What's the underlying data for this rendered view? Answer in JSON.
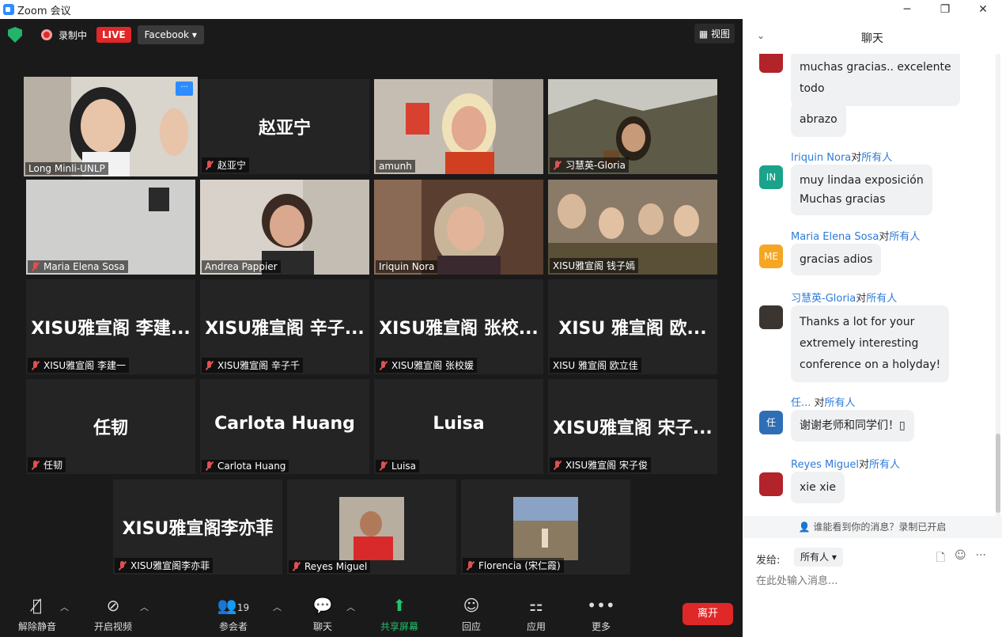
{
  "window": {
    "title": "Zoom 会议",
    "minimize": "─",
    "maximize": "❐",
    "close": "✕"
  },
  "topbar": {
    "recording": "录制中",
    "live": "LIVE",
    "stream_target": "Facebook ▾",
    "view": "▦ 视图"
  },
  "tiles": [
    {
      "label": "Long Minli-UNLP",
      "muted": false,
      "more": "···"
    },
    {
      "bigname": "赵亚宁",
      "label": "赵亚宁",
      "muted": true
    },
    {
      "label": "amunh",
      "muted": false
    },
    {
      "label": "习慧英-Gloria",
      "muted": true
    },
    {
      "label": "Maria Elena Sosa",
      "muted": true
    },
    {
      "label": "Andrea Pappier",
      "muted": false
    },
    {
      "label": "Iriquin Nora",
      "muted": false
    },
    {
      "label": "XISU雅宣阁 钱子嫣",
      "muted": false
    },
    {
      "bigname": "XISU雅宣阁 李建...",
      "label": "XISU雅宣阁 李建一",
      "muted": true
    },
    {
      "bigname": "XISU雅宣阁 辛子...",
      "label": "XISU雅宣阁 辛子千",
      "muted": true
    },
    {
      "bigname": "XISU雅宣阁 张校...",
      "label": "XISU雅宣阁 张校媛",
      "muted": true
    },
    {
      "bigname": "XISU 雅宣阁 欧...",
      "label": "XISU 雅宣阁 欧立佳",
      "muted": false
    },
    {
      "bigname": "任韧",
      "label": "任韧",
      "muted": true
    },
    {
      "bigname": "Carlota Huang",
      "label": "Carlota Huang",
      "muted": true
    },
    {
      "bigname": "Luisa",
      "label": "Luisa",
      "muted": true
    },
    {
      "bigname": "XISU雅宣阁 宋子...",
      "label": "XISU雅宣阁 宋子俊",
      "muted": true
    },
    {
      "bigname": "XISU雅宣阁李亦菲",
      "label": "XISU雅宣阁李亦菲",
      "muted": true
    },
    {
      "label": "Reyes Miguel",
      "muted": true
    },
    {
      "label": "Florencia (宋仁霞)",
      "muted": true
    }
  ],
  "toolbar": {
    "unmute": "解除静音",
    "start_video": "开启视频",
    "participants": "参会者",
    "participants_count": "19",
    "chat": "聊天",
    "share_screen": "共享屏幕",
    "reactions": "回应",
    "apps": "应用",
    "more": "更多",
    "leave": "离开"
  },
  "chat": {
    "title": "聊天",
    "privacy_notice": "谁能看到你的消息？录制已开启",
    "send_to_label": "发给:",
    "recipient": "所有人 ▾",
    "input_placeholder": "在此处输入消息...",
    "messages": [
      {
        "text1": "muchas gracias.. excelente",
        "text2": "todo"
      },
      {
        "text1": "abrazo"
      },
      {
        "sender": "Iriquin Nora",
        "to": "对",
        "recipient": "所有人",
        "avatar": "IN",
        "avatar_color": "#1aa38a",
        "text1": "muy lindaa exposición",
        "text2": "Muchas gracias"
      },
      {
        "sender": "Maria Elena Sosa",
        "to": "对",
        "recipient": "所有人",
        "avatar": "ME",
        "avatar_color": "#f5a623",
        "text1": "gracias adios"
      },
      {
        "sender": "习慧英-Gloria",
        "to": "对",
        "recipient": "所有人",
        "text1": "Thanks a lot for your",
        "text2": "extremely interesting",
        "text3": "conference on a holyday!"
      },
      {
        "sender": "任...",
        "to": " 对",
        "recipient": "所有人",
        "avatar": "任",
        "avatar_color": "#2f6db5",
        "text1": "谢谢老师和同学们！▯"
      },
      {
        "sender": "Reyes Miguel",
        "to": "对",
        "recipient": "所有人",
        "text1": "xie xie"
      }
    ]
  }
}
